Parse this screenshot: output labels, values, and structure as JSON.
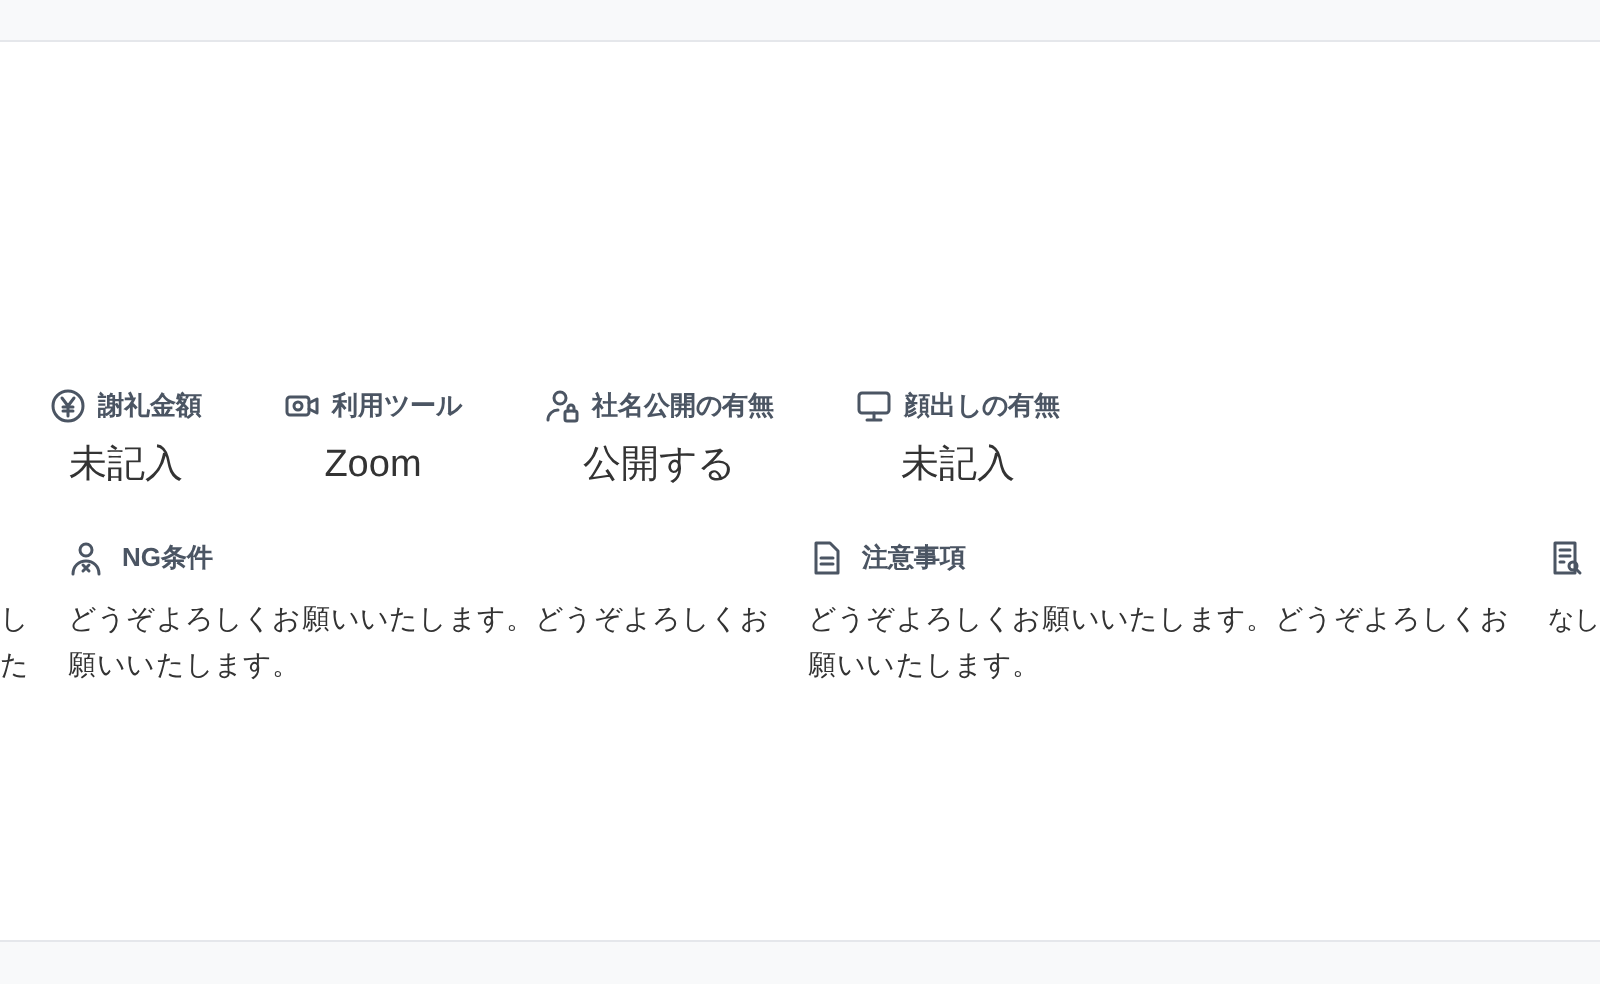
{
  "attributes": [
    {
      "kind": "yen",
      "label": "謝礼金額",
      "value": "未記入"
    },
    {
      "kind": "camera",
      "label": "利用ツール",
      "value": "Zoom"
    },
    {
      "kind": "person-lock",
      "label": "社名公開の有無",
      "value": "公開する"
    },
    {
      "kind": "monitor",
      "label": "顔出しの有無",
      "value": "未記入"
    }
  ],
  "notes_left_cut": [
    "し",
    "た"
  ],
  "notes": [
    {
      "kind": "person-x",
      "label": "NG条件",
      "text": "どうぞよろしくお願いいたします。どうぞよろしくお願いいたします。"
    },
    {
      "kind": "document",
      "label": "注意事項",
      "text": "どうぞよろしくお願いいたします。どうぞよろしくお願いいたします。"
    }
  ],
  "notes_right_cut": {
    "kind": "document-search",
    "text": "なし"
  }
}
